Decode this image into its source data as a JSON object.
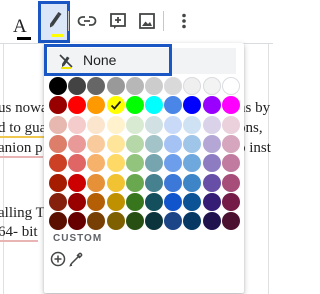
{
  "toolbar": {
    "text_color_letter": "A",
    "buttons": [
      "text-color",
      "highlight-color",
      "insert-link",
      "add-comment",
      "insert-image",
      "more-options"
    ]
  },
  "document": {
    "lines": [
      {
        "left": "us nowa",
        "right": "ns by"
      },
      {
        "left": "d to gua",
        "right": "ons,"
      },
      {
        "left": "anion p",
        "right": "o inst"
      },
      {
        "left": "alling T",
        "right": ""
      },
      {
        "left": "64- bit",
        "right": ""
      }
    ]
  },
  "highlight_menu": {
    "none_label": "None",
    "custom_label": "CUSTOM",
    "selected_color": "#ffff00",
    "palette": [
      [
        "#000000",
        "#434343",
        "#666666",
        "#999999",
        "#b7b7b7",
        "#cccccc",
        "#d9d9d9",
        "#efefef",
        "#f3f3f3",
        "#ffffff"
      ],
      [
        "#980000",
        "#ff0000",
        "#ff9900",
        "#ffff00",
        "#00ff00",
        "#00ffff",
        "#4a86e8",
        "#0000ff",
        "#9900ff",
        "#ff00ff"
      ],
      [
        "#e6b8af",
        "#f4cccc",
        "#fce5cd",
        "#fff2cc",
        "#d9ead3",
        "#d0e0e3",
        "#c9daf8",
        "#cfe2f3",
        "#d9d2e9",
        "#ead1dc"
      ],
      [
        "#dd7e6b",
        "#ea9999",
        "#f9cb9c",
        "#ffe599",
        "#b6d7a8",
        "#a2c4c9",
        "#a4c2f4",
        "#9fc5e8",
        "#b4a7d6",
        "#d5a6bd"
      ],
      [
        "#cc4125",
        "#e06666",
        "#f6b26b",
        "#ffd966",
        "#93c47d",
        "#76a5af",
        "#6d9eeb",
        "#6fa8dc",
        "#8e7cc3",
        "#c27ba0"
      ],
      [
        "#a61c00",
        "#cc0000",
        "#e69138",
        "#f1c232",
        "#6aa84f",
        "#45818e",
        "#3c78d8",
        "#3d85c6",
        "#674ea7",
        "#a64d79"
      ],
      [
        "#85200c",
        "#990000",
        "#b45f06",
        "#bf9000",
        "#38761d",
        "#134f5c",
        "#1155cc",
        "#0b5394",
        "#351c75",
        "#741b47"
      ],
      [
        "#5b0f00",
        "#660000",
        "#783f04",
        "#7f6000",
        "#274e13",
        "#0c343d",
        "#1c4587",
        "#073763",
        "#20124d",
        "#4c1130"
      ]
    ]
  }
}
